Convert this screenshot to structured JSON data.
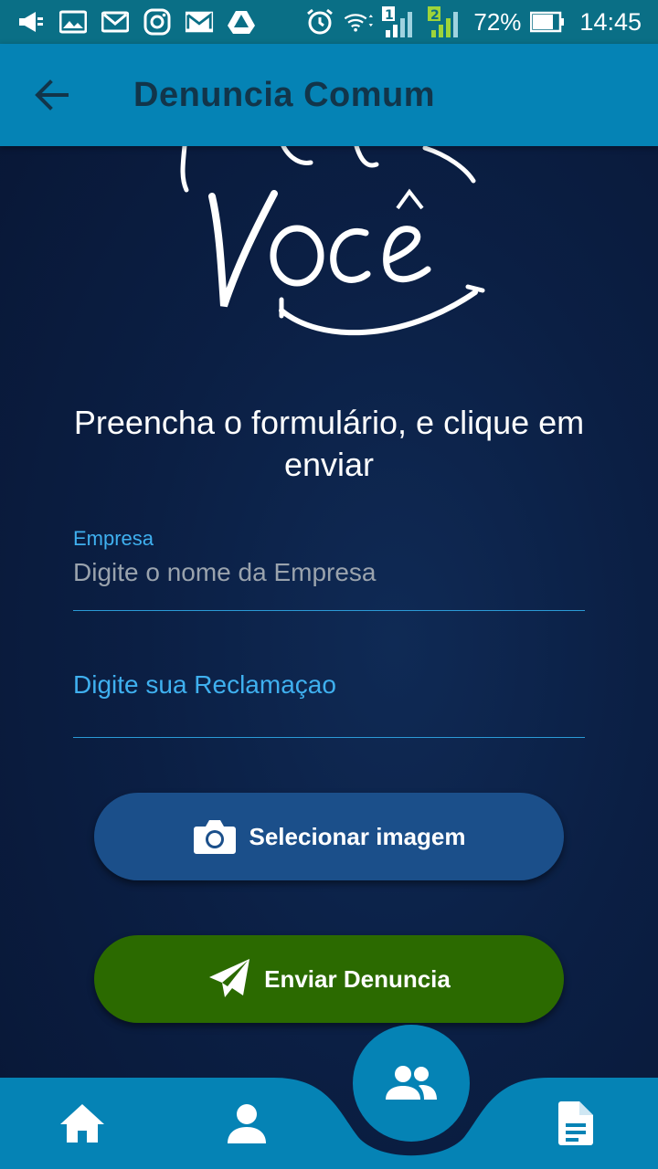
{
  "status_bar": {
    "battery_percent": "72%",
    "time": "14:45",
    "sim1": "1",
    "sim2": "2",
    "icons": [
      "megaphone-icon",
      "image-icon",
      "gmail-icon",
      "instagram-icon",
      "mail-icon",
      "drive-icon",
      "alarm-icon",
      "wifi-icon",
      "signal-icon",
      "battery-icon"
    ]
  },
  "app_bar": {
    "title": "Denuncia Comum",
    "back_icon": "arrow-back-icon"
  },
  "logo": {
    "text": "Você"
  },
  "form": {
    "instruction": "Preencha o formulário, e clique em enviar",
    "company_label": "Empresa",
    "company_placeholder": "Digite o nome da Empresa",
    "company_value": "",
    "complaint_placeholder": "Digite sua Reclamaçao",
    "complaint_value": ""
  },
  "buttons": {
    "select_image": "Selecionar imagem",
    "send": "Enviar Denuncia"
  },
  "colors": {
    "status_bar": "#0a6f86",
    "app_bar": "#0583b5",
    "background": "#0b1f44",
    "accent": "#3fb0ef",
    "select_button": "#1b4f8a",
    "send_button": "#2b6a00"
  },
  "bottom_nav": {
    "items": [
      "home-icon",
      "person-icon",
      "group-icon",
      "document-icon"
    ],
    "active": "group-icon"
  }
}
